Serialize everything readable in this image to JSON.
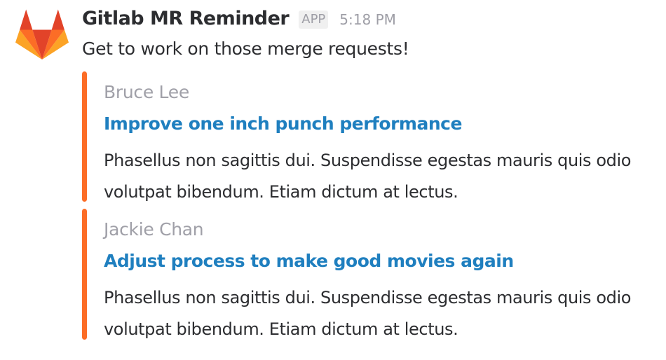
{
  "message": {
    "sender": "Gitlab MR Reminder",
    "badge": "APP",
    "timestamp": "5:18 PM",
    "text": "Get to work on those merge requests!"
  },
  "accent_color": "#fc6d26",
  "link_color": "#1f7fbf",
  "attachments": [
    {
      "author": "Bruce Lee",
      "title": "Improve one inch punch performance",
      "description": "Phasellus non sagittis dui. Suspendisse egestas mauris quis odio volutpat bibendum. Etiam dictum at lectus."
    },
    {
      "author": "Jackie Chan",
      "title": "Adjust process to make good movies again",
      "description": "Phasellus non sagittis dui. Suspendisse egestas mauris quis odio volutpat bibendum. Etiam dictum at lectus."
    }
  ],
  "icons": {
    "avatar": "gitlab-tanuki-icon"
  }
}
